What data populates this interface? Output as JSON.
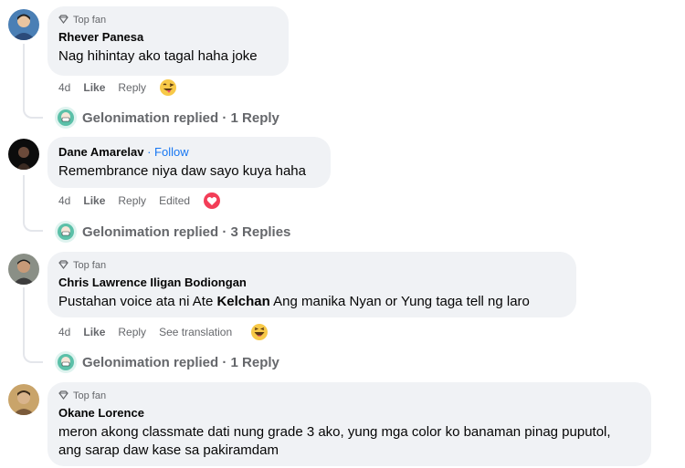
{
  "comments": [
    {
      "badge": "Top fan",
      "author": "Rhever Panesa",
      "text": "Nag hihintay ako tagal haha joke",
      "time": "4d",
      "like": "Like",
      "reply": "Reply",
      "extra": "",
      "reaction": "haha-tongue-emoji",
      "replies_summary": "Gelonimation replied · 1 Reply"
    },
    {
      "badge": "",
      "author": "Dane Amarelav",
      "follow_sep": " · ",
      "follow": "Follow",
      "text": "Remembrance niya daw sayo kuya haha",
      "time": "4d",
      "like": "Like",
      "reply": "Reply",
      "extra": "Edited",
      "reaction": "love-heart-emoji",
      "replies_summary": "Gelonimation replied · 3 Replies"
    },
    {
      "badge": "Top fan",
      "author": "Chris Lawrence Iligan Bodiongan",
      "text_pre": "Pustahan voice ata ni Ate ",
      "text_bold": "Kelchan",
      "text_post": " Ang manika Nyan or Yung taga tell ng laro",
      "time": "4d",
      "like": "Like",
      "reply": "Reply",
      "extra": "See translation",
      "reaction": "laugh-emoji",
      "replies_summary": "Gelonimation replied · 1 Reply"
    },
    {
      "badge": "Top fan",
      "author": "Okane Lorence",
      "text": "meron akong classmate dati nung grade 3 ako, yung mga color ko banaman pinag puputol, ang sarap daw kase sa pakiramdam"
    }
  ]
}
